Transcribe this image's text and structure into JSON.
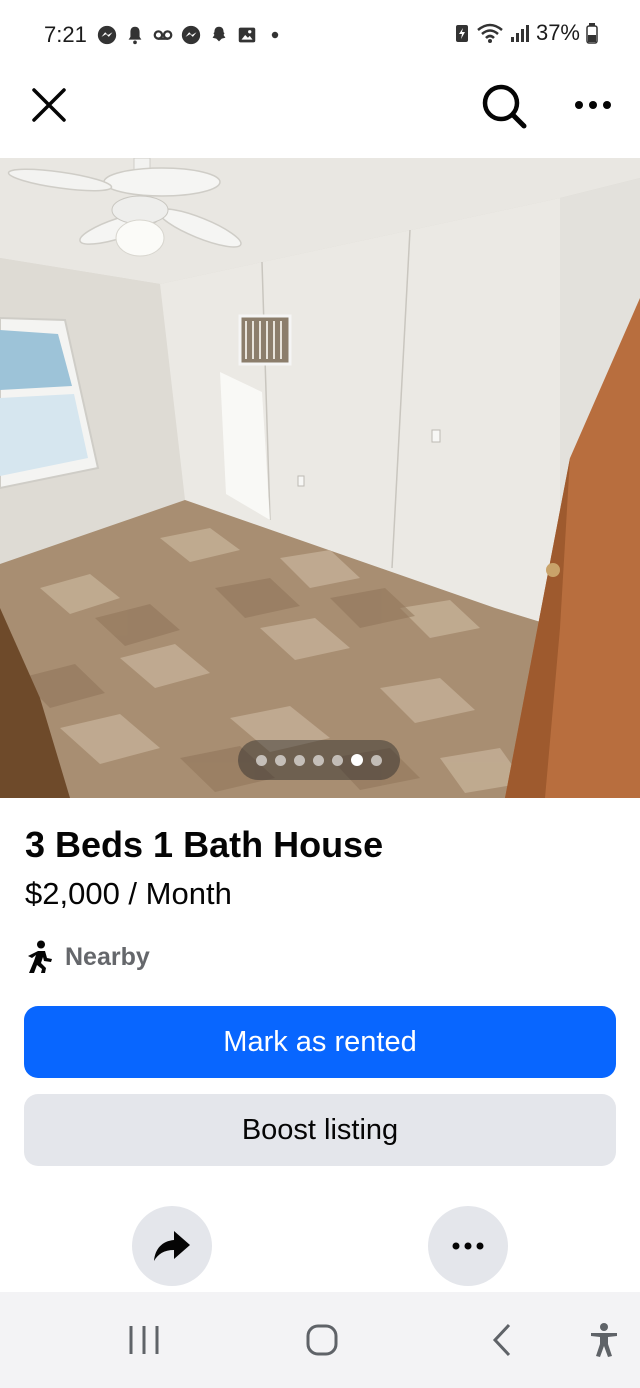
{
  "status_bar": {
    "time": "7:21",
    "battery": "37%",
    "left_icons": [
      "messenger-icon",
      "notification-bell-icon",
      "voicemail-icon",
      "messenger-icon",
      "snapchat-icon",
      "gallery-icon",
      "dot-icon"
    ],
    "right_icons": [
      "battery-saver-icon",
      "wifi-icon",
      "signal-icon",
      "battery-icon"
    ]
  },
  "top_bar": {
    "close_icon": "close-icon",
    "search_icon": "search-icon",
    "more_icon": "more-icon"
  },
  "listing": {
    "title": "3 Beds 1 Bath House",
    "price": "$2,000 / Month",
    "distance": "Nearby",
    "photo_count": 7,
    "active_photo_index": 5
  },
  "actions": {
    "primary_label": "Mark as rented",
    "secondary_label": "Boost listing",
    "share_icon": "share-icon",
    "more_icon": "more-icon"
  },
  "colors": {
    "primary": "#0866ff",
    "secondary_bg": "#e4e6eb",
    "muted_text": "#65676b"
  }
}
